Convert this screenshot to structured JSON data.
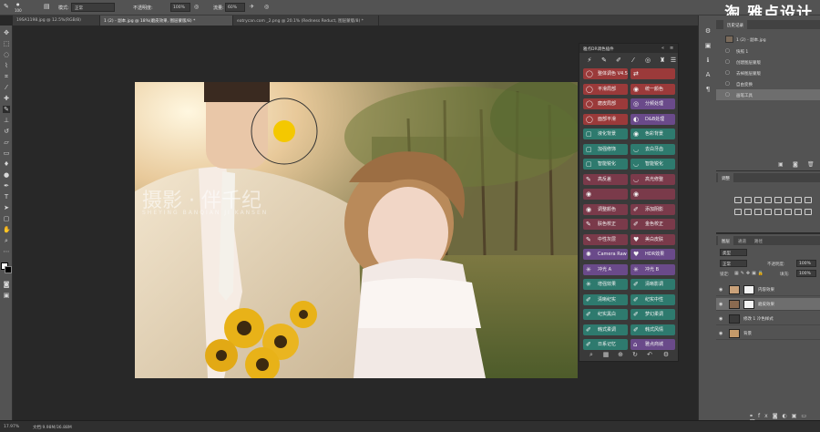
{
  "option_bar": {
    "brush_size": "100",
    "mode_label": "模式:",
    "mode_value": "正常",
    "opacity_label": "不透明度:",
    "opacity_value": "100%",
    "flow_label": "流量:",
    "flow_value": "60%"
  },
  "watermark": "淘 雅点设计",
  "tabs": [
    "19SA1198.jpg @ 12.5%(RGB/8)",
    "1 (2) - 副本.jpg @ 18%(磨皮效果, 图层蒙版/8) *",
    "eatrycan.com _2.png @ 20.1% (Redness Reduct, 图层蒙版/8) *"
  ],
  "plugin": {
    "title": "雅点DR调色插件",
    "buttons": [
      {
        "label": "整体调色 V4.5",
        "color": "#9b3a3a",
        "icon": "bubble-icon"
      },
      {
        "label": "",
        "color": "#9b3a3a",
        "icon": "swap-icon"
      },
      {
        "label": "平滑局部",
        "color": "#9b3a3a",
        "icon": "bubble-icon"
      },
      {
        "label": "统一颜色",
        "color": "#9b3a3a",
        "icon": "drop-icon"
      },
      {
        "label": "磨皮局部",
        "color": "#9b3a3a",
        "icon": "bubble-icon"
      },
      {
        "label": "分频处理",
        "color": "#6a4a8a",
        "icon": "swirl-icon"
      },
      {
        "label": "面部平滑",
        "color": "#9b3a3a",
        "icon": "bubble-icon"
      },
      {
        "label": "D&B处理",
        "color": "#6a4a8a",
        "icon": "contrast-icon"
      },
      {
        "label": "液化背景",
        "color": "#2e7a6e",
        "icon": "frame-icon"
      },
      {
        "label": "色彩背景",
        "color": "#2e7a6e",
        "icon": "eye-icon"
      },
      {
        "label": "加强修饰",
        "color": "#2e7a6e",
        "icon": "frame-icon"
      },
      {
        "label": "去白牙齿",
        "color": "#2e7a6e",
        "icon": "lips-icon"
      },
      {
        "label": "智能锐化",
        "color": "#2e7a6e",
        "icon": "frame-icon"
      },
      {
        "label": "智能锐化",
        "color": "#2e7a6e",
        "icon": "lips-icon"
      },
      {
        "label": "高反差",
        "color": "#7a3a4a",
        "icon": "brush-icon"
      },
      {
        "label": "高光修整",
        "color": "#7a3a4a",
        "icon": "lips-icon"
      },
      {
        "label": "",
        "color": "#7a3a4a",
        "icon": "eye-icon"
      },
      {
        "label": "",
        "color": "#7a3a4a",
        "icon": "eye-icon"
      },
      {
        "label": "调整颜色",
        "color": "#7a3a4a",
        "icon": "eye-icon"
      },
      {
        "label": "添加阴影",
        "color": "#7a3a4a",
        "icon": "pin-icon"
      },
      {
        "label": "肤色校正",
        "color": "#7a3a4a",
        "icon": "brush-icon"
      },
      {
        "label": "金色校正",
        "color": "#7a3a4a",
        "icon": "pin-icon"
      },
      {
        "label": "中性灰层",
        "color": "#7a3a4a",
        "icon": "brush-icon"
      },
      {
        "label": "美白皮肤",
        "color": "#7a3a4a",
        "icon": "heart-icon"
      },
      {
        "label": "Camera Raw",
        "color": "#6a4a8a",
        "icon": "gear-icon"
      },
      {
        "label": "HDR效果",
        "color": "#6a4a8a",
        "icon": "heart-icon"
      },
      {
        "label": "冲光 A",
        "color": "#6a4a8a",
        "icon": "star-icon"
      },
      {
        "label": "冲光 B",
        "color": "#6a4a8a",
        "icon": "star-icon"
      },
      {
        "label": "增强效果",
        "color": "#2e7a6e",
        "icon": "star-icon"
      },
      {
        "label": "清晰影调",
        "color": "#2e7a6e",
        "icon": "pin-icon"
      },
      {
        "label": "清晰纪实",
        "color": "#2e7a6e",
        "icon": "pin-icon"
      },
      {
        "label": "纪实中性",
        "color": "#2e7a6e",
        "icon": "pin-icon"
      },
      {
        "label": "纪实黑白",
        "color": "#2e7a6e",
        "icon": "pin-icon"
      },
      {
        "label": "梦幻柔调",
        "color": "#2e7a6e",
        "icon": "pin-icon"
      },
      {
        "label": "韩式柔调",
        "color": "#2e7a6e",
        "icon": "pin-icon"
      },
      {
        "label": "韩式风情",
        "color": "#2e7a6e",
        "icon": "pin-icon"
      },
      {
        "label": "日系记忆",
        "color": "#2e7a6e",
        "icon": "pin-icon"
      },
      {
        "label": "雅点商城",
        "color": "#6a4a8a",
        "icon": "shop-icon"
      }
    ]
  },
  "history": {
    "tabs": [
      "历史记录"
    ],
    "snapshot": "1 (2) - 副本.jpg",
    "items": [
      "快照 1",
      "创建图层蒙版",
      "去掉图层蒙版",
      "自由变换",
      "画笔工具"
    ],
    "selected_index": 4
  },
  "adjust": {
    "tab": "调整"
  },
  "layers": {
    "tabs": [
      "图层",
      "通道",
      "路径"
    ],
    "filter": "类型",
    "blend": "正常",
    "opacity_label": "不透明度:",
    "opacity": "100%",
    "lock_label": "锁定:",
    "fill_label": "填充:",
    "fill": "100%",
    "rows": [
      {
        "name": "内容效果",
        "selected": false
      },
      {
        "name": "磨皮效果",
        "selected": true
      },
      {
        "name": "修改 1 冷色样式",
        "selected": false
      },
      {
        "name": "背景",
        "selected": false
      }
    ]
  },
  "status": {
    "zoom": "17.97%",
    "doc": "文档:9.98M/36.88M"
  },
  "canvas_watermark": {
    "line1": "摄影 · 伴千纪",
    "line2": "SHEYING BANQIAN JI KANSEN"
  },
  "accent_colors": {
    "brush_cursor": "#f4c800"
  }
}
